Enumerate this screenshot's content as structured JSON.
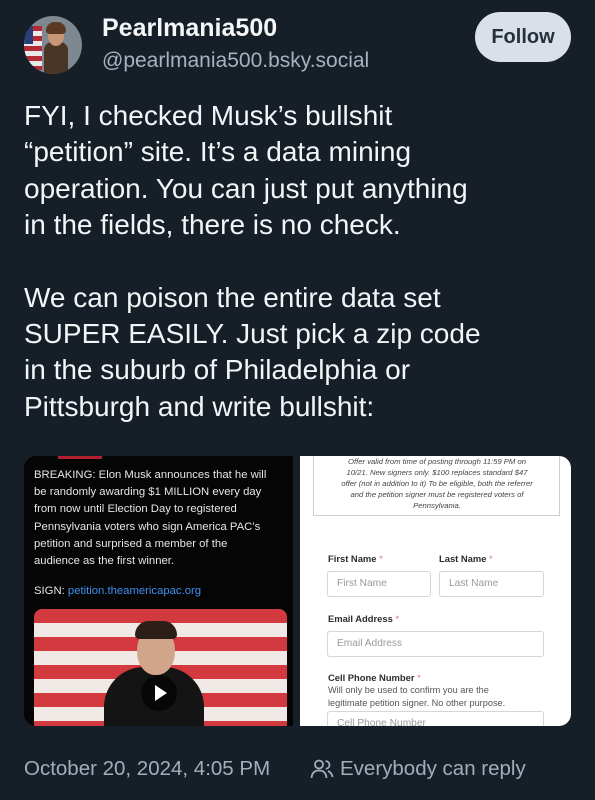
{
  "author": {
    "display_name": "Pearlmania500",
    "handle": "@pearlmania500.bsky.social",
    "follow_label": "Follow"
  },
  "post": {
    "paragraph_1_lines": [
      "FYI, I checked Musk’s bullshit",
      "“petition” site. It’s a data mining",
      "operation. You can just put anything",
      "in the fields, there is no check."
    ],
    "paragraph_2_lines": [
      "We can poison the entire data set",
      "SUPER EASILY. Just pick a zip code",
      "in the suburb of Philadelphia or",
      "Pittsburgh and write bullshit:"
    ]
  },
  "image_left": {
    "news_lines": [
      "BREAKING: Elon Musk announces that he will",
      "be randomly awarding $1 MILLION every day",
      "from now until Election Day to registered",
      "Pennsylvania voters who sign America PAC’s",
      "petition and surprised a member of the",
      "audience as the first winner."
    ],
    "sign_prefix": "SIGN: ",
    "sign_link": "petition.theamericapac.org"
  },
  "image_right": {
    "offer_lines": [
      "Offer valid from time of posting through 11:59 PM on",
      "10/21. New signers only. $100 replaces standard $47",
      "offer (not in addition to it) To be eligible, both the referrer",
      "and the petition signer must be registered voters of",
      "Pennsylvania."
    ],
    "first_name_label": "First Name",
    "last_name_label": "Last Name",
    "required_mark": "*",
    "first_name_placeholder": "First Name",
    "last_name_placeholder": "Last Name",
    "email_label": "Email Address",
    "email_placeholder": "Email Address",
    "phone_label": "Cell Phone Number",
    "phone_note_lines": [
      "Will only be used to confirm you are the",
      "legitimate petition signer. No other purpose."
    ],
    "phone_placeholder": "Cell Phone Number"
  },
  "footer": {
    "timestamp": "October 20, 2024, 4:05 PM",
    "reply_setting": "Everybody can reply",
    "reply_icon": "people-icon"
  },
  "colors": {
    "background": "#161e27",
    "follow_button": "#d9e0e8",
    "link_blue": "#3f8ff0",
    "muted_text": "#a3aebb"
  }
}
